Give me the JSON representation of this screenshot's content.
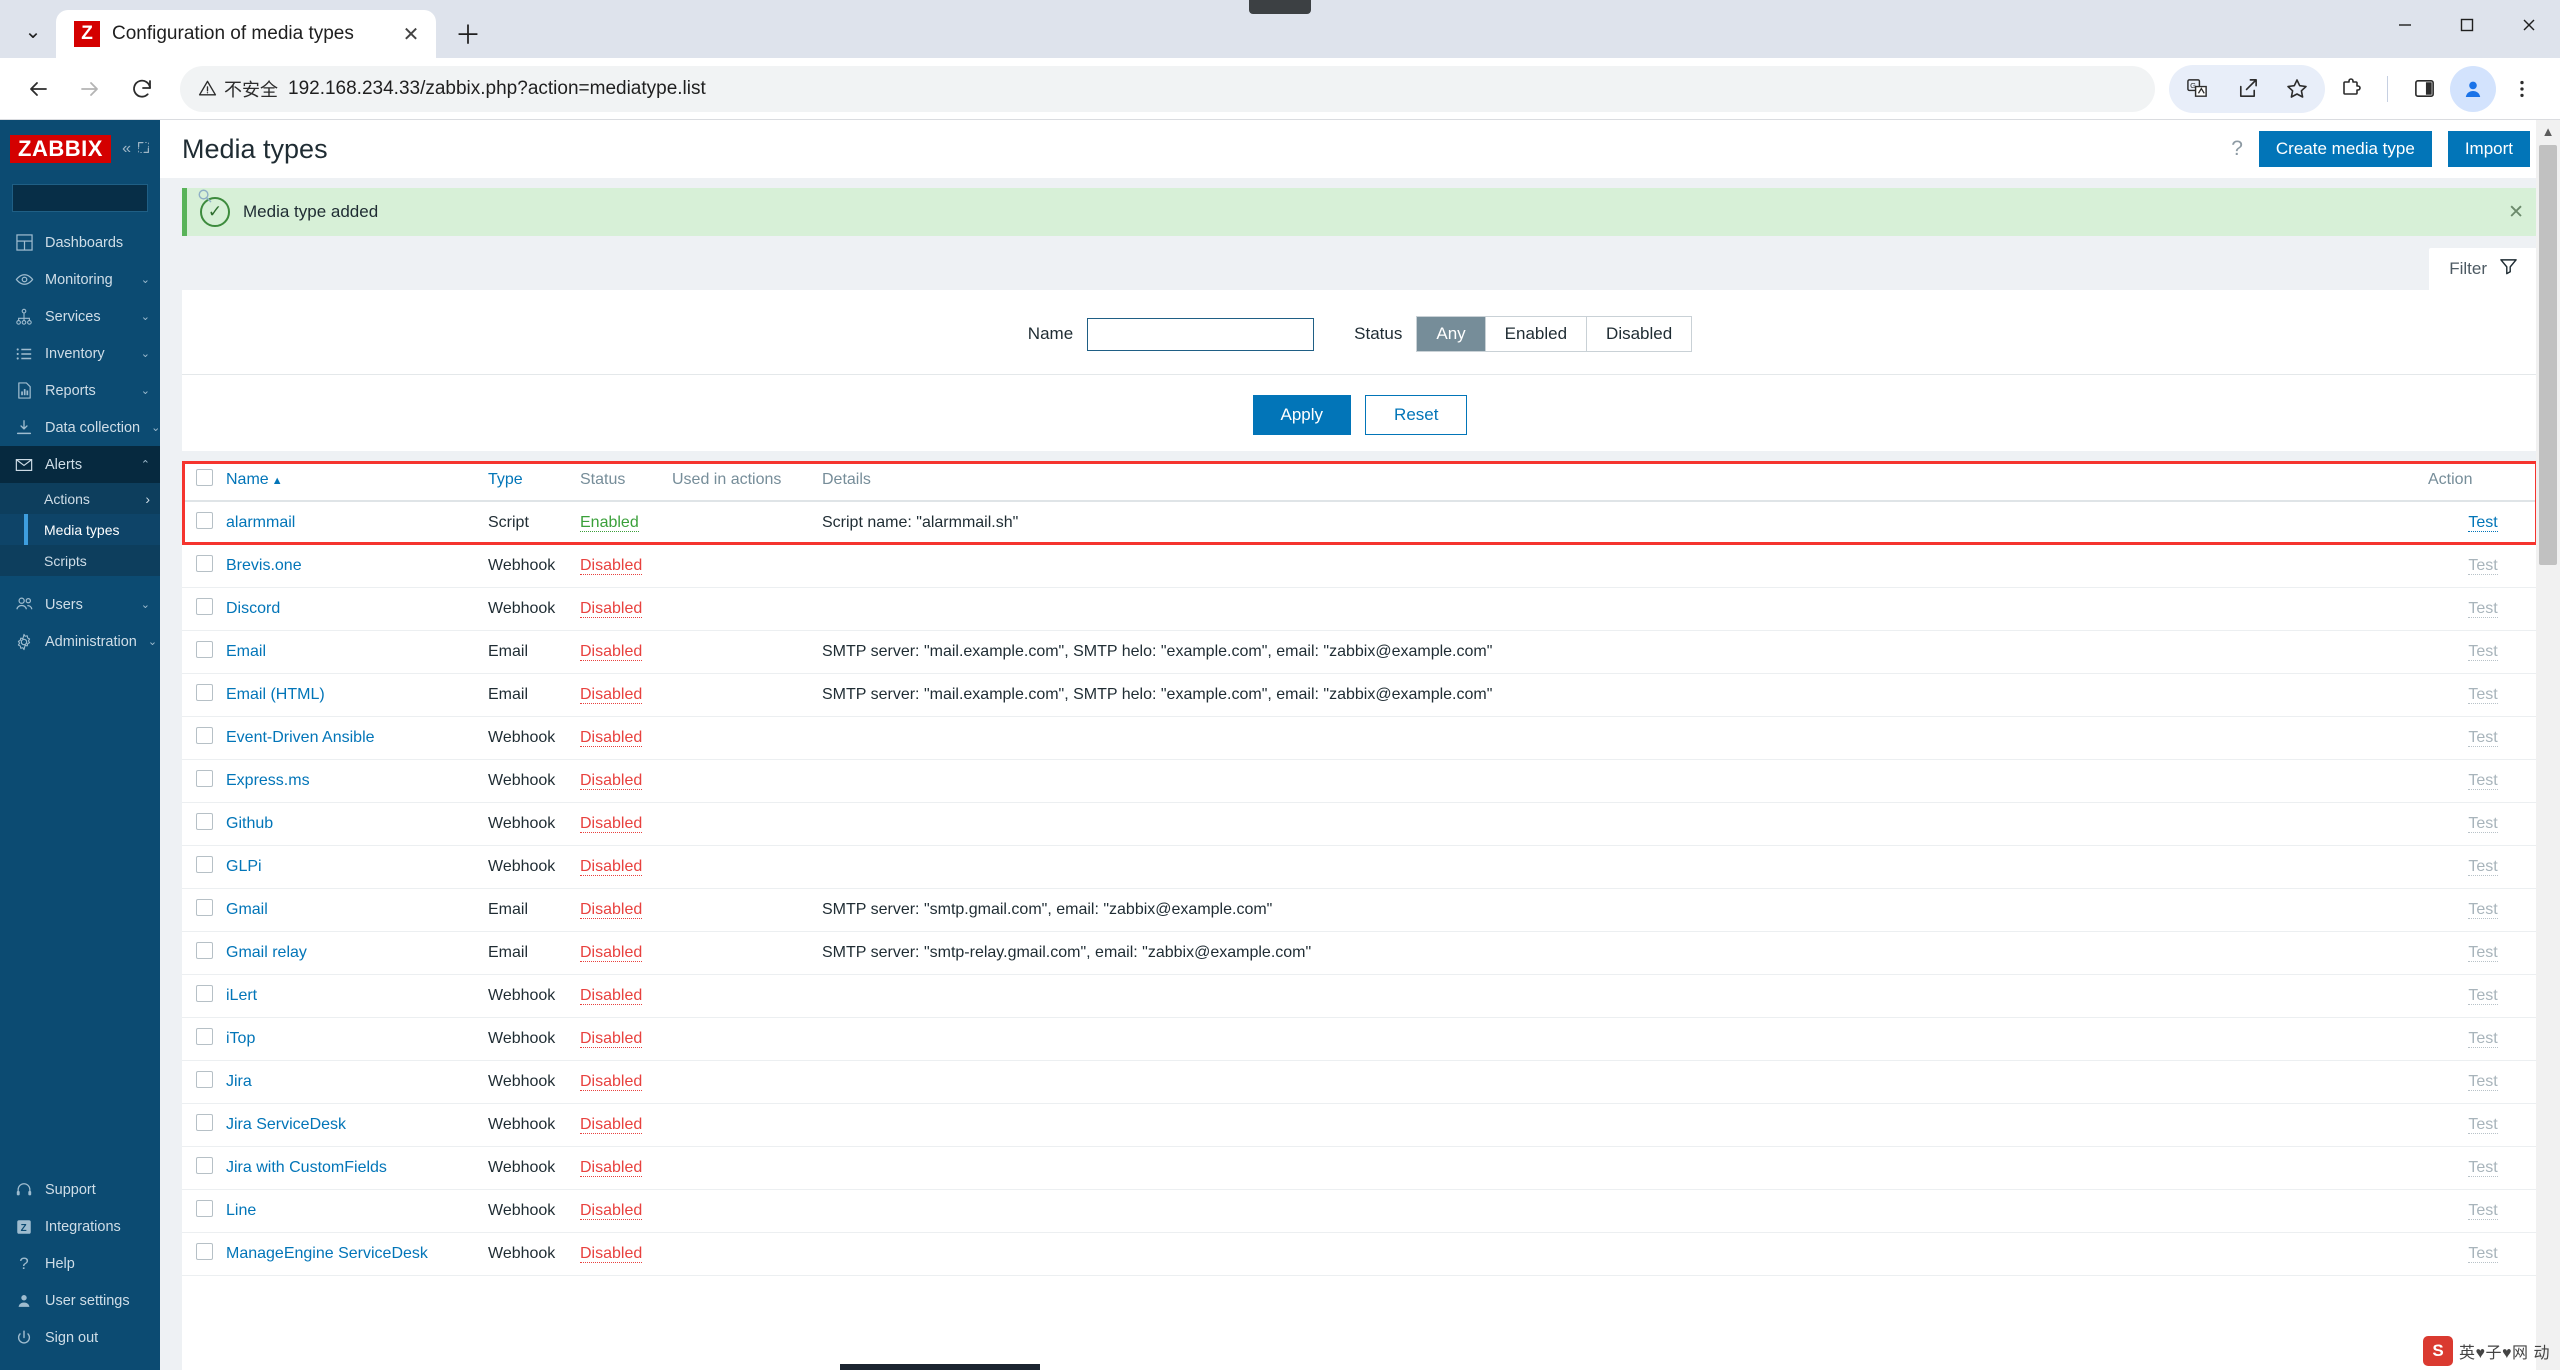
{
  "browser": {
    "tab": {
      "title": "Configuration of media types",
      "favicon_label": "Z",
      "close_icon": "✕",
      "new_tab_icon": "＋",
      "dropdown_icon": "⌄"
    },
    "window_controls": {
      "minimize": "—",
      "maximize": "▢",
      "close": "✕"
    },
    "nav": {
      "back_icon": "←",
      "forward_icon": "→",
      "reload_icon": "⟳"
    },
    "omnibox": {
      "warning_icon": "⚠",
      "security_label": "不安全",
      "url": "192.168.234.33/zabbix.php?action=mediatype.list"
    },
    "toolbar_icons": [
      "translate-icon",
      "share-icon",
      "bookmark-star-icon",
      "extensions-icon",
      "side-panel-icon",
      "profile-avatar-icon",
      "browser-menu-icon"
    ]
  },
  "sidebar": {
    "logo": "ZABBIX",
    "collapse_icons": {
      "collapse": "«",
      "hide": "⛶"
    },
    "search_placeholder": "",
    "search_value": "",
    "items": [
      {
        "label": "Dashboards",
        "icon": "dashboard-icon",
        "chevron": ""
      },
      {
        "label": "Monitoring",
        "icon": "eye-icon",
        "chevron": "⌄"
      },
      {
        "label": "Services",
        "icon": "sitemap-icon",
        "chevron": "⌄"
      },
      {
        "label": "Inventory",
        "icon": "list-icon",
        "chevron": "⌄"
      },
      {
        "label": "Reports",
        "icon": "report-chart-icon",
        "chevron": "⌄"
      },
      {
        "label": "Data collection",
        "icon": "download-icon",
        "chevron": "⌄"
      },
      {
        "label": "Alerts",
        "icon": "envelope-icon",
        "chevron": "⌃"
      },
      {
        "label": "Users",
        "icon": "users-icon",
        "chevron": "⌄"
      },
      {
        "label": "Administration",
        "icon": "gear-icon",
        "chevron": "⌄"
      }
    ],
    "alerts_submenu": [
      {
        "label": "Actions",
        "chevron": "›"
      },
      {
        "label": "Media types",
        "chevron": ""
      },
      {
        "label": "Scripts",
        "chevron": ""
      }
    ],
    "footer_items": [
      {
        "label": "Support",
        "icon": "headset-icon"
      },
      {
        "label": "Integrations",
        "icon": "zabbix-z-icon"
      },
      {
        "label": "Help",
        "icon": "question-icon"
      },
      {
        "label": "User settings",
        "icon": "user-icon"
      },
      {
        "label": "Sign out",
        "icon": "power-icon"
      }
    ]
  },
  "header": {
    "title": "Media types",
    "help_icon": "?",
    "create_button": "Create media type",
    "import_button": "Import"
  },
  "message": {
    "text": "Media type added",
    "icon": "check-icon",
    "close_icon": "✕"
  },
  "filter": {
    "tab_label": "Filter",
    "tab_icon": "funnel-icon",
    "name_label": "Name",
    "name_value": "",
    "name_placeholder": "",
    "status_label": "Status",
    "status_options": [
      "Any",
      "Enabled",
      "Disabled"
    ],
    "status_selected": "Any",
    "apply_button": "Apply",
    "reset_button": "Reset"
  },
  "table": {
    "columns": {
      "name": "Name",
      "sort_arrow": "▲",
      "type": "Type",
      "status": "Status",
      "used_in_actions": "Used in actions",
      "details": "Details",
      "action": "Action"
    },
    "action_label": "Test",
    "rows": [
      {
        "name": "alarmmail",
        "type": "Script",
        "status": "Enabled",
        "used": "",
        "details": "Script name: \"alarmmail.sh\"",
        "action": "Test",
        "action_active": true
      },
      {
        "name": "Brevis.one",
        "type": "Webhook",
        "status": "Disabled",
        "used": "",
        "details": "",
        "action": "Test",
        "action_active": false
      },
      {
        "name": "Discord",
        "type": "Webhook",
        "status": "Disabled",
        "used": "",
        "details": "",
        "action": "Test",
        "action_active": false
      },
      {
        "name": "Email",
        "type": "Email",
        "status": "Disabled",
        "used": "",
        "details": "SMTP server: \"mail.example.com\", SMTP helo: \"example.com\", email: \"zabbix@example.com\"",
        "action": "Test",
        "action_active": false
      },
      {
        "name": "Email (HTML)",
        "type": "Email",
        "status": "Disabled",
        "used": "",
        "details": "SMTP server: \"mail.example.com\", SMTP helo: \"example.com\", email: \"zabbix@example.com\"",
        "action": "Test",
        "action_active": false
      },
      {
        "name": "Event-Driven Ansible",
        "type": "Webhook",
        "status": "Disabled",
        "used": "",
        "details": "",
        "action": "Test",
        "action_active": false
      },
      {
        "name": "Express.ms",
        "type": "Webhook",
        "status": "Disabled",
        "used": "",
        "details": "",
        "action": "Test",
        "action_active": false
      },
      {
        "name": "Github",
        "type": "Webhook",
        "status": "Disabled",
        "used": "",
        "details": "",
        "action": "Test",
        "action_active": false
      },
      {
        "name": "GLPi",
        "type": "Webhook",
        "status": "Disabled",
        "used": "",
        "details": "",
        "action": "Test",
        "action_active": false
      },
      {
        "name": "Gmail",
        "type": "Email",
        "status": "Disabled",
        "used": "",
        "details": "SMTP server: \"smtp.gmail.com\", email: \"zabbix@example.com\"",
        "action": "Test",
        "action_active": false
      },
      {
        "name": "Gmail relay",
        "type": "Email",
        "status": "Disabled",
        "used": "",
        "details": "SMTP server: \"smtp-relay.gmail.com\", email: \"zabbix@example.com\"",
        "action": "Test",
        "action_active": false
      },
      {
        "name": "iLert",
        "type": "Webhook",
        "status": "Disabled",
        "used": "",
        "details": "",
        "action": "Test",
        "action_active": false
      },
      {
        "name": "iTop",
        "type": "Webhook",
        "status": "Disabled",
        "used": "",
        "details": "",
        "action": "Test",
        "action_active": false
      },
      {
        "name": "Jira",
        "type": "Webhook",
        "status": "Disabled",
        "used": "",
        "details": "",
        "action": "Test",
        "action_active": false
      },
      {
        "name": "Jira ServiceDesk",
        "type": "Webhook",
        "status": "Disabled",
        "used": "",
        "details": "",
        "action": "Test",
        "action_active": false
      },
      {
        "name": "Jira with CustomFields",
        "type": "Webhook",
        "status": "Disabled",
        "used": "",
        "details": "",
        "action": "Test",
        "action_active": false
      },
      {
        "name": "Line",
        "type": "Webhook",
        "status": "Disabled",
        "used": "",
        "details": "",
        "action": "Test",
        "action_active": false
      },
      {
        "name": "ManageEngine ServiceDesk",
        "type": "Webhook",
        "status": "Disabled",
        "used": "",
        "details": "",
        "action": "Test",
        "action_active": false
      }
    ]
  },
  "watermark": {
    "badge": "S",
    "text": "英♥子♥网 动"
  }
}
